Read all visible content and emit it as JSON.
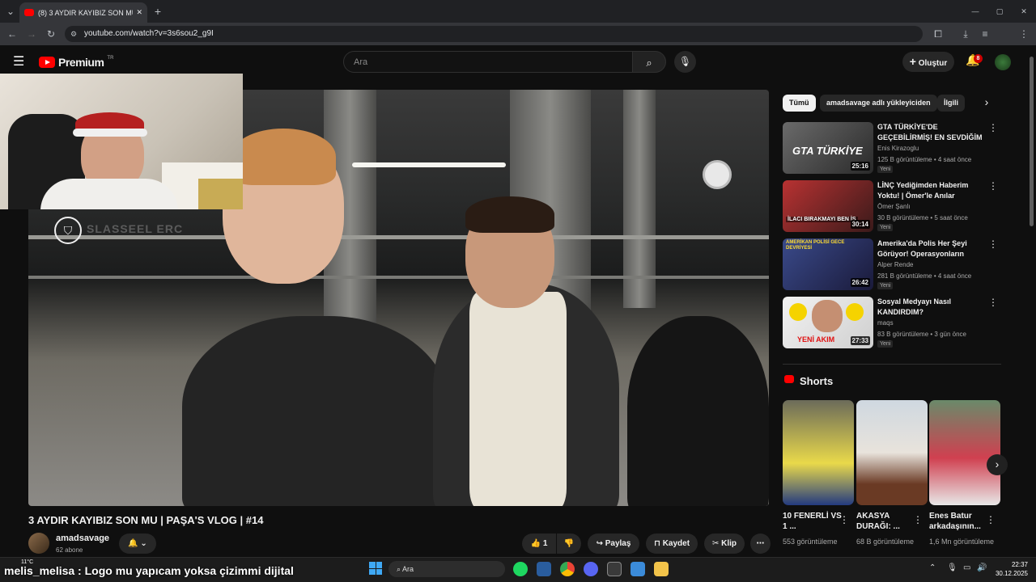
{
  "browser": {
    "tab_title": "(8) 3 AYDIR KAYIBIZ SON MU | P",
    "tab_close": "✕",
    "new_tab": "+",
    "url": "youtube.com/watch?v=3s6sou2_g9I",
    "window_controls": [
      "—",
      "▢",
      "✕"
    ]
  },
  "header": {
    "logo_text": "Premium",
    "logo_region": "TR",
    "search_placeholder": "Ara",
    "create_label": "Oluştur",
    "notification_count": "8"
  },
  "video": {
    "title": "3 AYDIR KAYIBIZ SON MU | PAŞA'S VLOG | #14",
    "channel": "amadsavage",
    "subscribers": "62 abone",
    "like_count": "1",
    "share_label": "Paylaş",
    "save_label": "Kaydet",
    "clip_label": "Klip",
    "watermark": "SLASSEEL ERC"
  },
  "sidebar": {
    "chips": [
      "Tümü",
      "amadsavage adlı yükleyiciden",
      "İlgili"
    ],
    "recommendations": [
      {
        "title": "GTA TÜRKİYE'DE GEÇEBİLİRMİŞ! EN SEVDİĞİM ...",
        "channel": "Enis Kirazoglu",
        "meta": "125 B görüntüleme • 4 saat önce",
        "badge": "Yeni",
        "duration": "25:16",
        "thumb_text": "GTA TÜRKİYE"
      },
      {
        "title": "LİNÇ Yediğimden Haberim Yoktu! | Ömer'le Anılar @gokalaf",
        "channel": "Ömer Şanlı",
        "meta": "30 B görüntüleme • 5 saat önce",
        "badge": "Yeni",
        "duration": "30:14",
        "thumb_text": "İLACI BIRAKMAYI BEN İS"
      },
      {
        "title": "Amerika'da Polis Her Şeyi Görüyor! Operasyonların Perde...",
        "channel": "Alper Rende",
        "meta": "281 B görüntüleme • 4 saat önce",
        "badge": "Yeni",
        "duration": "26:42",
        "thumb_text": "AMERİKAN POLİSİ GECE DEVRİYESİ"
      },
      {
        "title": "Sosyal Medyayı Nasıl KANDIRDIM?",
        "channel": "maqs",
        "meta": "83 B görüntüleme • 3 gün önce",
        "badge": "Yeni",
        "duration": "27:33",
        "thumb_text": "YENİ AKIM"
      }
    ],
    "shorts_label": "Shorts",
    "shorts": [
      {
        "title": "10 FENERLİ VS 1 ...",
        "views": "553 görüntüleme"
      },
      {
        "title": "AKASYA DURAĞI: ...",
        "views": "68 B görüntüleme"
      },
      {
        "title": "Enes Batur arkadaşının...",
        "views": "1,6 Mn görüntüleme"
      }
    ]
  },
  "taskbar": {
    "overlay_text": "melis_melisa : Logo mu yapıcam yoksa çizimmi dijital",
    "weather": "11°C",
    "search_label": "Ara",
    "time": "22:37",
    "date": "30.12.2025"
  },
  "colors": {
    "accent": "#ff0000",
    "background": "#0f0f0f",
    "chip_active": "#f1f1f1"
  }
}
